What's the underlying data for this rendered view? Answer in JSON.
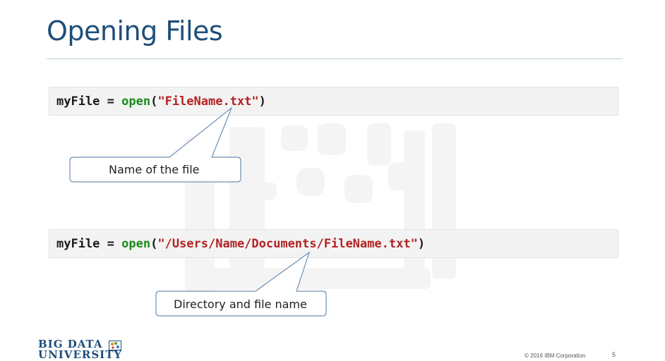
{
  "slide": {
    "title": "Opening Files",
    "page_number": "5",
    "copyright": "© 2016 IBM Corporation"
  },
  "examples": [
    {
      "variable": "myFile",
      "operator": " = ",
      "function": "open",
      "open_paren": "(",
      "string": "\"FileName.txt\"",
      "close_paren": ")",
      "callout": "Name of the file"
    },
    {
      "variable": "myFile",
      "operator": " = ",
      "function": "open",
      "open_paren": "(",
      "string": "\"/Users/Name/Documents/FileName.txt\"",
      "close_paren": ")",
      "callout": "Directory and file name"
    }
  ],
  "footer": {
    "logo_line1": "BIG DATA",
    "logo_line2": "UNIVERSITY",
    "logo_icon": "dots-cube-icon"
  },
  "colors": {
    "title": "#1f4e79",
    "function": "#1a8a1a",
    "string": "#b22222",
    "callout_border": "#6f8fb0"
  }
}
